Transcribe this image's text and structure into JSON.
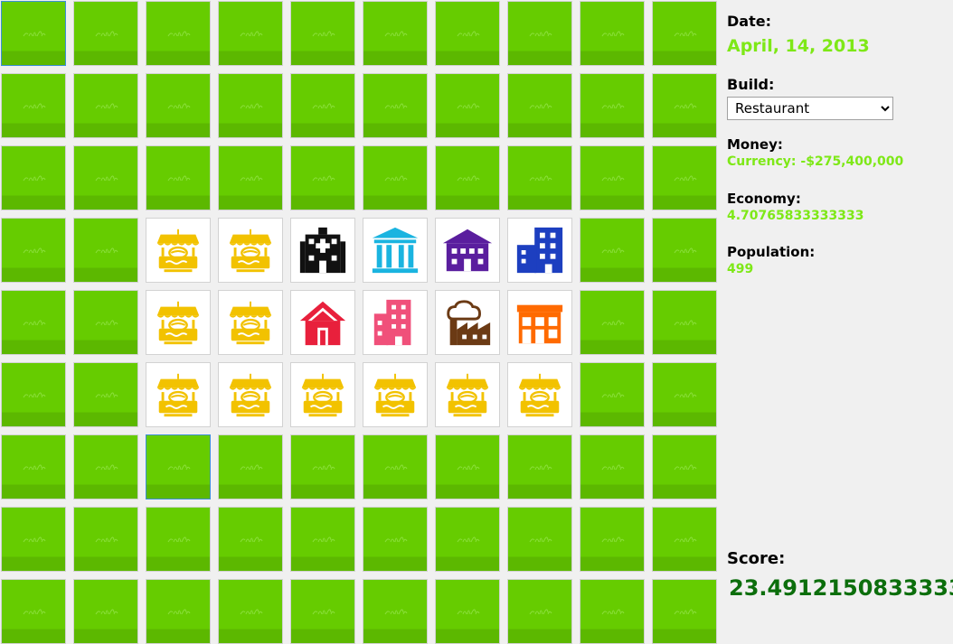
{
  "panel": {
    "date_label": "Date:",
    "date_value": "April, 14, 2013",
    "build_label": "Build:",
    "build_selected": "Restaurant",
    "money_label": "Money:",
    "money_value": "Currency: -$275,400,000",
    "economy_label": "Economy:",
    "economy_value": "4.70765833333333",
    "population_label": "Population:",
    "population_value": "499",
    "score_label": "Score:",
    "score_value": "23.4912150833333"
  },
  "colors": {
    "grass": "#66cc00",
    "stat_value": "#7ee817",
    "score_value": "#0c6e0c",
    "restaurant": "#f2c200",
    "hospital": "#111111",
    "museum": "#1ab4e0",
    "school": "#5a1e9e",
    "office": "#1d3fc0",
    "house": "#e8203c",
    "apartment": "#f0507a",
    "factory": "#6b3a14",
    "store": "#ff6a00"
  },
  "grid": {
    "rows": 9,
    "cols": 10,
    "selected": [
      6,
      2
    ],
    "highlighted": [
      0,
      0
    ],
    "cells": [
      [
        "grass",
        "grass",
        "grass",
        "grass",
        "grass",
        "grass",
        "grass",
        "grass",
        "grass",
        "grass"
      ],
      [
        "grass",
        "grass",
        "grass",
        "grass",
        "grass",
        "grass",
        "grass",
        "grass",
        "grass",
        "grass"
      ],
      [
        "grass",
        "grass",
        "grass",
        "grass",
        "grass",
        "grass",
        "grass",
        "grass",
        "grass",
        "grass"
      ],
      [
        "grass",
        "grass",
        "restaurant",
        "restaurant",
        "hospital",
        "museum",
        "school",
        "office",
        "grass",
        "grass"
      ],
      [
        "grass",
        "grass",
        "restaurant",
        "restaurant",
        "house",
        "apartment",
        "factory",
        "store",
        "grass",
        "grass"
      ],
      [
        "grass",
        "grass",
        "restaurant",
        "restaurant",
        "restaurant",
        "restaurant",
        "restaurant",
        "restaurant",
        "grass",
        "grass"
      ],
      [
        "grass",
        "grass",
        "grass",
        "grass",
        "grass",
        "grass",
        "grass",
        "grass",
        "grass",
        "grass"
      ],
      [
        "grass",
        "grass",
        "grass",
        "grass",
        "grass",
        "grass",
        "grass",
        "grass",
        "grass",
        "grass"
      ],
      [
        "grass",
        "grass",
        "grass",
        "grass",
        "grass",
        "grass",
        "grass",
        "grass",
        "grass",
        "grass"
      ]
    ]
  }
}
